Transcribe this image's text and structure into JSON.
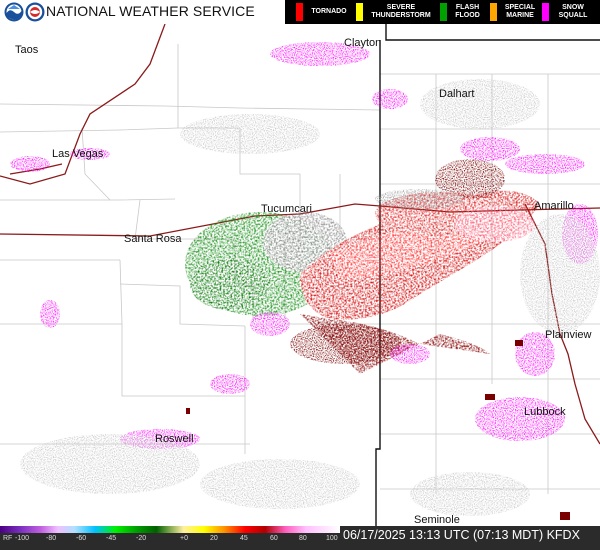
{
  "header": {
    "agency": "NATIONAL WEATHER SERVICE",
    "legend": [
      {
        "label": "TORNADO",
        "color": "#ff0000"
      },
      {
        "label": "SEVERE THUNDERSTORM",
        "color": "#ffff00"
      },
      {
        "label": "FLASH FLOOD",
        "color": "#00a000"
      },
      {
        "label": "SPECIAL MARINE",
        "color": "#ffa500"
      },
      {
        "label": "SNOW SQUALL",
        "color": "#ff00ff"
      }
    ]
  },
  "cities": [
    "Taos",
    "Clayton",
    "Dalhart",
    "Las Vegas",
    "Tucumcari",
    "Amarillo",
    "Santa Rosa",
    "Plainview",
    "Lubbock",
    "Roswell",
    "Seminole"
  ],
  "scale": {
    "prefix": "RF",
    "ticks": [
      "-100",
      "-80",
      "-60",
      "-45",
      "-20",
      "+0",
      "20",
      "45",
      "60",
      "80",
      "100"
    ]
  },
  "timestamp": "06/17/2025 13:13 UTC (07:13 MDT) KFDX"
}
